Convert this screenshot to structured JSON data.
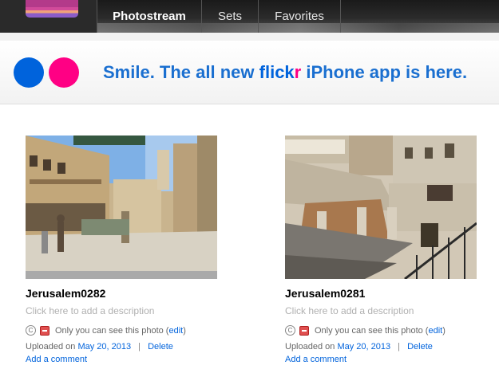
{
  "nav": {
    "tabs": [
      {
        "label": "Photostream",
        "active": true
      },
      {
        "label": "Sets",
        "active": false
      },
      {
        "label": "Favorites",
        "active": false
      }
    ]
  },
  "banner": {
    "text_before": "Smile. The all new",
    "brand_a": "flick",
    "brand_b": "r",
    "text_after": "iPhone app is here.",
    "colors": {
      "blue": "#0063dc",
      "pink": "#ff0084"
    }
  },
  "photos": [
    {
      "title": "Jerusalem0282",
      "description_placeholder": "Click here to add a description",
      "privacy_text": "Only you can see this photo (",
      "edit_label": "edit",
      "privacy_close": ")",
      "uploaded_prefix": "Uploaded on",
      "uploaded_date": "May 20, 2013",
      "separator": "|",
      "delete_label": "Delete",
      "comment_label": "Add a comment"
    },
    {
      "title": "Jerusalem0281",
      "description_placeholder": "Click here to add a description",
      "privacy_text": "Only you can see this photo (",
      "edit_label": "edit",
      "privacy_close": ")",
      "uploaded_prefix": "Uploaded on",
      "uploaded_date": "May 20, 2013",
      "separator": "|",
      "delete_label": "Delete",
      "comment_label": "Add a comment"
    }
  ],
  "icons": {
    "copyright": "copyright-icon",
    "private": "private-icon"
  }
}
